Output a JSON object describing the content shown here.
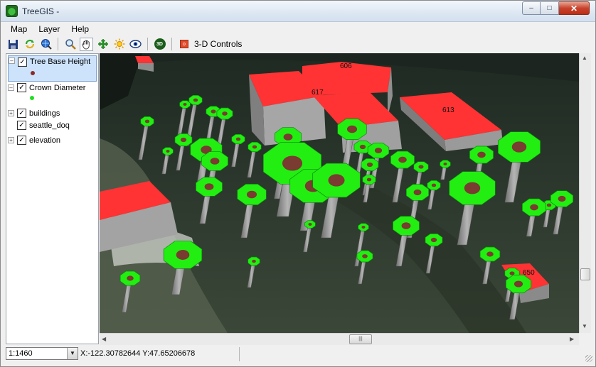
{
  "window": {
    "title": "TreeGIS -"
  },
  "window_buttons": {
    "minimize": "–",
    "maximize": "□",
    "close": "✕"
  },
  "menu": {
    "items": [
      "Map",
      "Layer",
      "Help"
    ]
  },
  "toolbar": {
    "icons": [
      "save-icon",
      "refresh-icon",
      "globe-search-icon",
      "zoom-icon",
      "pan-hand-icon",
      "move-icon",
      "sun-icon",
      "eye-icon",
      "3d-icon"
    ],
    "three_d_badge": "3D",
    "controls_label": "3-D Controls"
  },
  "layers": {
    "items": [
      {
        "label": "Tree Base Height",
        "checked": true,
        "expander": "–",
        "legend_color": "#8a2b2b"
      },
      {
        "label": "Crown Diameter",
        "checked": true,
        "expander": "–",
        "legend_color": "#22dd22"
      },
      {
        "label": "buildings",
        "checked": true,
        "expander": "+"
      },
      {
        "label": "seattle_doq",
        "checked": true,
        "expander": ""
      },
      {
        "label": "elevation",
        "checked": true,
        "expander": "+"
      }
    ]
  },
  "map": {
    "building_labels": [
      "606",
      "617",
      "613",
      "650"
    ],
    "colors": {
      "roof": "#ff3333",
      "crown": "#22ee11",
      "trunk": "#8a8a8a",
      "ground": "#3a4436"
    }
  },
  "status": {
    "scale": "1:1460",
    "coords": "X:-122.30782644 Y:47.65206678"
  }
}
